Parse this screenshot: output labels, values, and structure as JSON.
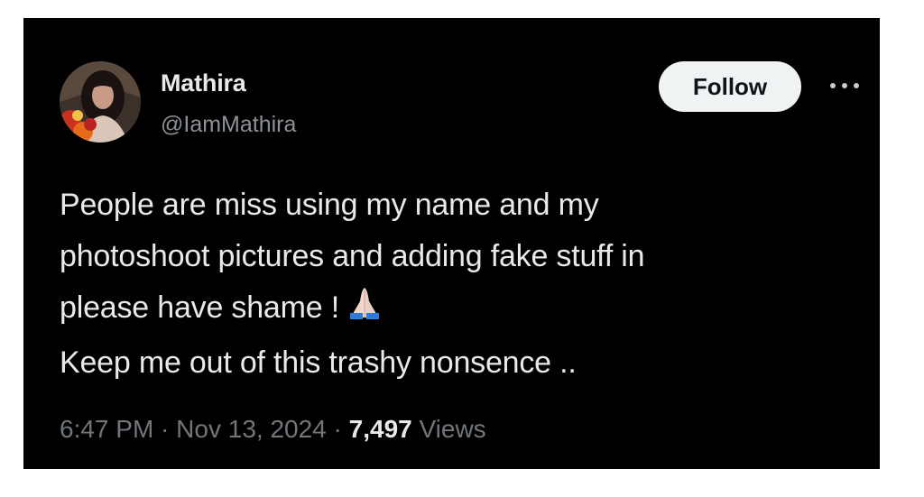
{
  "tweet": {
    "author": {
      "display_name": "Mathira",
      "handle": "@IamMathira",
      "avatar": "profile-photo"
    },
    "follow_label": "Follow",
    "more_icon": "more-horizontal-icon",
    "text_lines": [
      "People are miss using my name and my",
      "photoshoot pictures and adding  fake stuff in",
      "please have shame !",
      "Keep me out of this trashy nonsence .."
    ],
    "emoji": "folded-hands-icon",
    "time": "6:47 PM",
    "separator": "·",
    "date": "Nov 13, 2024",
    "views_count": "7,497",
    "views_label": "Views"
  },
  "colors": {
    "card_background": "#000000",
    "primary_text": "#e7e9ea",
    "secondary_text": "#71767b",
    "follow_button_bg": "#eff3f4"
  }
}
